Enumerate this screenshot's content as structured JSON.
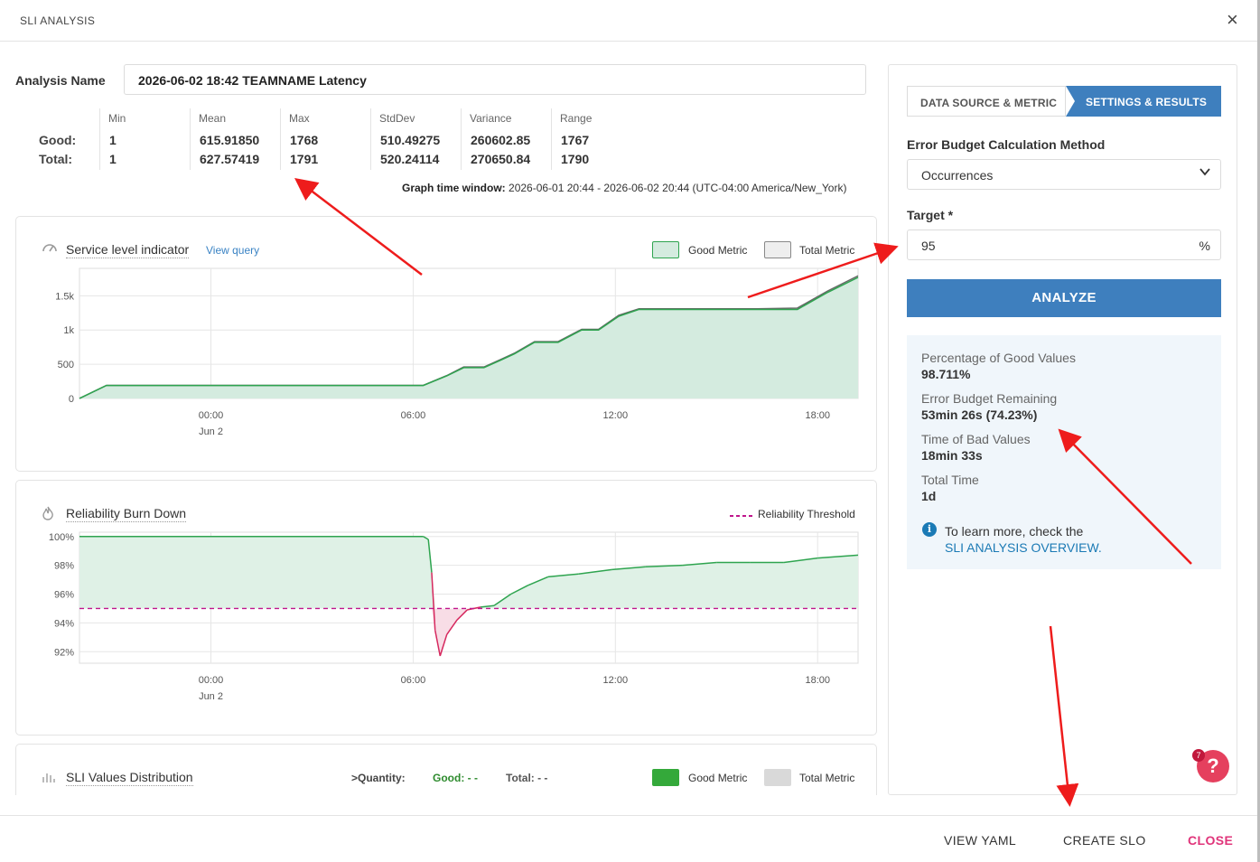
{
  "modal": {
    "title": "SLI ANALYSIS",
    "close_icon": "×"
  },
  "analysis": {
    "label": "Analysis Name",
    "value": "2026-06-02 18:42 TEAMNAME Latency"
  },
  "stats": {
    "headers": [
      "Min",
      "Mean",
      "Max",
      "StdDev",
      "Variance",
      "Range"
    ],
    "rows": [
      {
        "label": "Good:",
        "values": [
          "1",
          "615.91850",
          "1768",
          "510.49275",
          "260602.85",
          "1767"
        ]
      },
      {
        "label": "Total:",
        "values": [
          "1",
          "627.57419",
          "1791",
          "520.24114",
          "270650.84",
          "1790"
        ]
      }
    ]
  },
  "graph_window": {
    "label": "Graph time window:",
    "value": "2026-06-01 20:44 - 2026-06-02 20:44 (UTC-04:00 America/New_York)"
  },
  "sli_card": {
    "title": "Service level indicator",
    "view_query": "View query",
    "legend_good": "Good Metric",
    "legend_total": "Total Metric",
    "icon": "gauge-icon"
  },
  "burn_card": {
    "title": "Reliability Burn Down",
    "legend_threshold": "Reliability Threshold",
    "icon": "flame-icon"
  },
  "dist_card": {
    "title": "SLI Values Distribution",
    "quantity_label": ">Quantity:",
    "good_label": "Good: - -",
    "total_label": "Total: - -",
    "legend_good": "Good Metric",
    "legend_total": "Total Metric",
    "icon": "bar-chart-icon"
  },
  "colors": {
    "good": "#2ea44f",
    "good_fill": "#d4ebdf",
    "threshold": "#c0168c",
    "accent": "#3e7fbe",
    "close": "#e0347a"
  },
  "chart_data": [
    {
      "type": "line",
      "title": "Service level indicator",
      "x_ticks": [
        "00:00",
        "06:00",
        "12:00",
        "18:00"
      ],
      "x_sublabel": "Jun 2",
      "y_ticks": [
        "0",
        "500",
        "1k",
        "1.5k"
      ],
      "ylim": [
        0,
        1900
      ],
      "x_hours": [
        -3.9,
        -3.1,
        0,
        3,
        6.3,
        7,
        7.5,
        8.1,
        8.6,
        9.0,
        9.6,
        10.3,
        11.0,
        11.5,
        12.1,
        12.7,
        13.1,
        13.7,
        14.0,
        14.6,
        15.0,
        15.6,
        16.2,
        17.4,
        18.3,
        19.2
      ],
      "series": [
        {
          "name": "Good Metric",
          "values": [
            1,
            190,
            190,
            190,
            190,
            330,
            450,
            450,
            560,
            650,
            820,
            820,
            1000,
            1000,
            1200,
            1300,
            1300,
            1300,
            1300,
            1300,
            1300,
            1300,
            1300,
            1300,
            1550,
            1768
          ]
        },
        {
          "name": "Total Metric",
          "values": [
            1,
            192,
            192,
            192,
            192,
            335,
            460,
            460,
            570,
            660,
            830,
            830,
            1010,
            1010,
            1215,
            1310,
            1310,
            1310,
            1310,
            1310,
            1310,
            1310,
            1310,
            1320,
            1570,
            1791
          ]
        }
      ]
    },
    {
      "type": "line",
      "title": "Reliability Burn Down",
      "x_ticks": [
        "00:00",
        "06:00",
        "12:00",
        "18:00"
      ],
      "x_sublabel": "Jun 2",
      "y_ticks": [
        "92%",
        "94%",
        "96%",
        "98%",
        "100%"
      ],
      "ylim": [
        91.2,
        100.3
      ],
      "threshold": 95,
      "x_hours": [
        -3.9,
        6.3,
        6.45,
        6.55,
        6.65,
        6.8,
        7.0,
        7.3,
        7.6,
        8.0,
        8.4,
        8.9,
        9.4,
        10.0,
        10.9,
        11.9,
        12.9,
        14.0,
        15.0,
        16.0,
        17.0,
        18.0,
        19.2
      ],
      "series": [
        {
          "name": "Reliability",
          "values": [
            100,
            100,
            99.8,
            97.5,
            93.5,
            91.7,
            93.2,
            94.2,
            94.9,
            95.1,
            95.2,
            96.0,
            96.6,
            97.2,
            97.4,
            97.7,
            97.9,
            98.0,
            98.2,
            98.2,
            98.2,
            98.5,
            98.711
          ]
        }
      ]
    }
  ],
  "right_panel": {
    "tab1": "DATA SOURCE & METRIC",
    "tab2": "SETTINGS & RESULTS",
    "method_label": "Error Budget Calculation Method",
    "method_value": "Occurrences",
    "target_label": "Target *",
    "target_value": "95",
    "target_unit": "%",
    "analyze_label": "ANALYZE",
    "results": [
      {
        "label": "Percentage of Good Values",
        "value": "98.711%"
      },
      {
        "label": "Error Budget Remaining",
        "value": "53min 26s (74.23%)"
      },
      {
        "label": "Time of Bad Values",
        "value": "18min 33s"
      },
      {
        "label": "Total Time",
        "value": "1d"
      }
    ],
    "info_icon": "i",
    "info_text": "To learn more, check the",
    "info_link": "SLI ANALYSIS OVERVIEW."
  },
  "help": {
    "icon": "?",
    "badge": "7"
  },
  "footer": {
    "view_yaml": "VIEW YAML",
    "create_slo": "CREATE SLO",
    "close": "CLOSE"
  }
}
